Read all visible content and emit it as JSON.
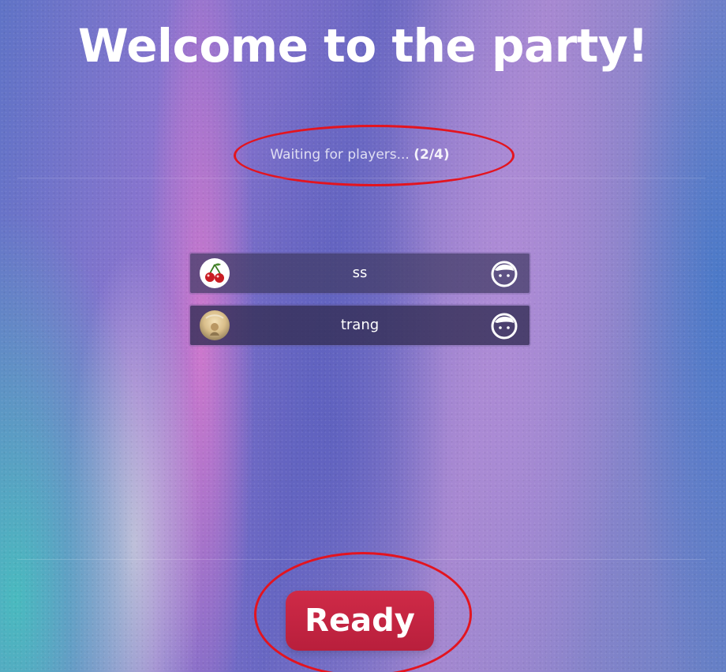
{
  "header": {
    "title": "Welcome to the party!"
  },
  "status": {
    "prefix": "Waiting for players...",
    "count": "(2/4)"
  },
  "players": [
    {
      "name": "ss",
      "avatar_icon": "cherry-icon",
      "status_icon": "face-icon"
    },
    {
      "name": "trang",
      "avatar_icon": "profile-photo",
      "status_icon": "face-icon"
    }
  ],
  "actions": {
    "ready_label": "Ready"
  },
  "colors": {
    "ready_button": "#c32341",
    "highlight_outline": "#e3141f"
  }
}
